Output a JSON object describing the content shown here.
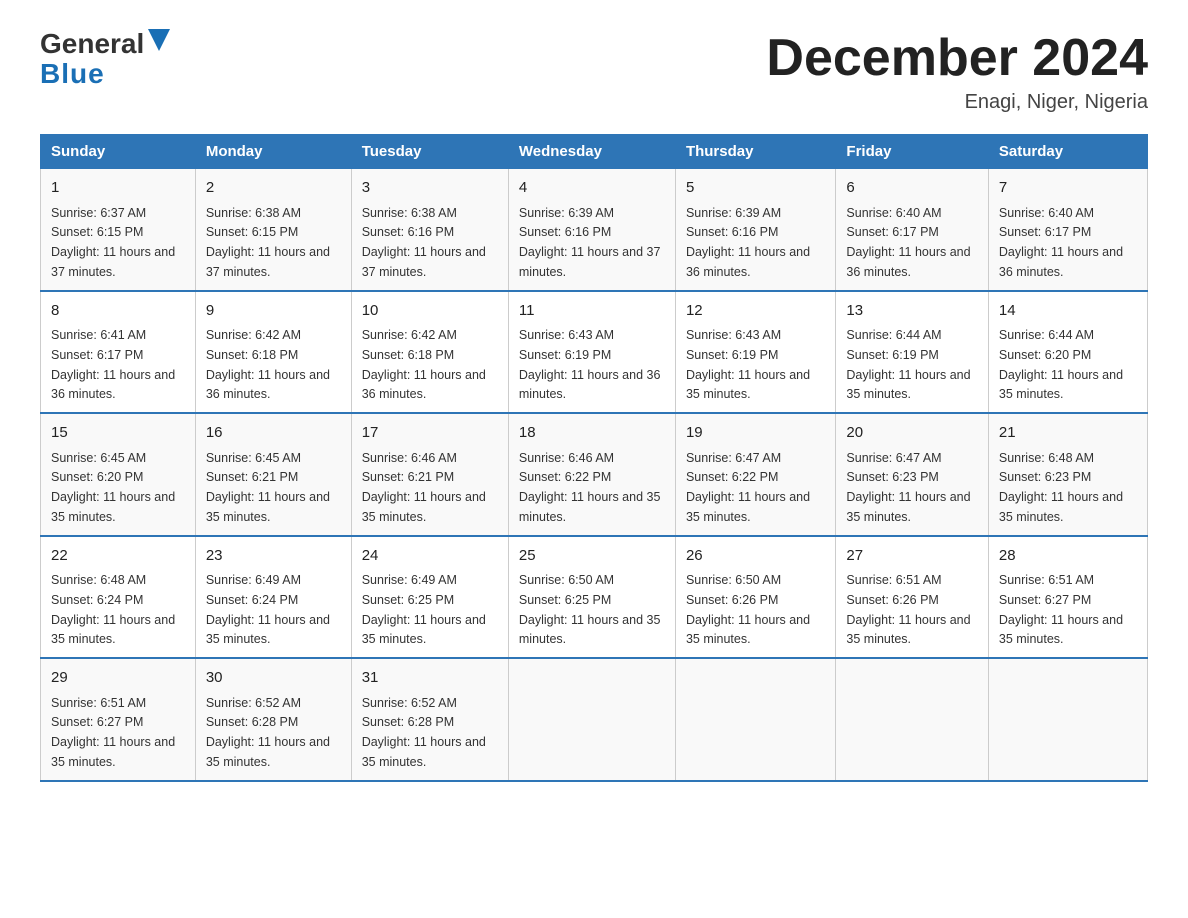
{
  "header": {
    "logo_line1": "General",
    "logo_line2": "Blue",
    "month_title": "December 2024",
    "location": "Enagi, Niger, Nigeria"
  },
  "days_of_week": [
    "Sunday",
    "Monday",
    "Tuesday",
    "Wednesday",
    "Thursday",
    "Friday",
    "Saturday"
  ],
  "weeks": [
    [
      {
        "day": "1",
        "sunrise": "6:37 AM",
        "sunset": "6:15 PM",
        "daylight": "11 hours and 37 minutes."
      },
      {
        "day": "2",
        "sunrise": "6:38 AM",
        "sunset": "6:15 PM",
        "daylight": "11 hours and 37 minutes."
      },
      {
        "day": "3",
        "sunrise": "6:38 AM",
        "sunset": "6:16 PM",
        "daylight": "11 hours and 37 minutes."
      },
      {
        "day": "4",
        "sunrise": "6:39 AM",
        "sunset": "6:16 PM",
        "daylight": "11 hours and 37 minutes."
      },
      {
        "day": "5",
        "sunrise": "6:39 AM",
        "sunset": "6:16 PM",
        "daylight": "11 hours and 36 minutes."
      },
      {
        "day": "6",
        "sunrise": "6:40 AM",
        "sunset": "6:17 PM",
        "daylight": "11 hours and 36 minutes."
      },
      {
        "day": "7",
        "sunrise": "6:40 AM",
        "sunset": "6:17 PM",
        "daylight": "11 hours and 36 minutes."
      }
    ],
    [
      {
        "day": "8",
        "sunrise": "6:41 AM",
        "sunset": "6:17 PM",
        "daylight": "11 hours and 36 minutes."
      },
      {
        "day": "9",
        "sunrise": "6:42 AM",
        "sunset": "6:18 PM",
        "daylight": "11 hours and 36 minutes."
      },
      {
        "day": "10",
        "sunrise": "6:42 AM",
        "sunset": "6:18 PM",
        "daylight": "11 hours and 36 minutes."
      },
      {
        "day": "11",
        "sunrise": "6:43 AM",
        "sunset": "6:19 PM",
        "daylight": "11 hours and 36 minutes."
      },
      {
        "day": "12",
        "sunrise": "6:43 AM",
        "sunset": "6:19 PM",
        "daylight": "11 hours and 35 minutes."
      },
      {
        "day": "13",
        "sunrise": "6:44 AM",
        "sunset": "6:19 PM",
        "daylight": "11 hours and 35 minutes."
      },
      {
        "day": "14",
        "sunrise": "6:44 AM",
        "sunset": "6:20 PM",
        "daylight": "11 hours and 35 minutes."
      }
    ],
    [
      {
        "day": "15",
        "sunrise": "6:45 AM",
        "sunset": "6:20 PM",
        "daylight": "11 hours and 35 minutes."
      },
      {
        "day": "16",
        "sunrise": "6:45 AM",
        "sunset": "6:21 PM",
        "daylight": "11 hours and 35 minutes."
      },
      {
        "day": "17",
        "sunrise": "6:46 AM",
        "sunset": "6:21 PM",
        "daylight": "11 hours and 35 minutes."
      },
      {
        "day": "18",
        "sunrise": "6:46 AM",
        "sunset": "6:22 PM",
        "daylight": "11 hours and 35 minutes."
      },
      {
        "day": "19",
        "sunrise": "6:47 AM",
        "sunset": "6:22 PM",
        "daylight": "11 hours and 35 minutes."
      },
      {
        "day": "20",
        "sunrise": "6:47 AM",
        "sunset": "6:23 PM",
        "daylight": "11 hours and 35 minutes."
      },
      {
        "day": "21",
        "sunrise": "6:48 AM",
        "sunset": "6:23 PM",
        "daylight": "11 hours and 35 minutes."
      }
    ],
    [
      {
        "day": "22",
        "sunrise": "6:48 AM",
        "sunset": "6:24 PM",
        "daylight": "11 hours and 35 minutes."
      },
      {
        "day": "23",
        "sunrise": "6:49 AM",
        "sunset": "6:24 PM",
        "daylight": "11 hours and 35 minutes."
      },
      {
        "day": "24",
        "sunrise": "6:49 AM",
        "sunset": "6:25 PM",
        "daylight": "11 hours and 35 minutes."
      },
      {
        "day": "25",
        "sunrise": "6:50 AM",
        "sunset": "6:25 PM",
        "daylight": "11 hours and 35 minutes."
      },
      {
        "day": "26",
        "sunrise": "6:50 AM",
        "sunset": "6:26 PM",
        "daylight": "11 hours and 35 minutes."
      },
      {
        "day": "27",
        "sunrise": "6:51 AM",
        "sunset": "6:26 PM",
        "daylight": "11 hours and 35 minutes."
      },
      {
        "day": "28",
        "sunrise": "6:51 AM",
        "sunset": "6:27 PM",
        "daylight": "11 hours and 35 minutes."
      }
    ],
    [
      {
        "day": "29",
        "sunrise": "6:51 AM",
        "sunset": "6:27 PM",
        "daylight": "11 hours and 35 minutes."
      },
      {
        "day": "30",
        "sunrise": "6:52 AM",
        "sunset": "6:28 PM",
        "daylight": "11 hours and 35 minutes."
      },
      {
        "day": "31",
        "sunrise": "6:52 AM",
        "sunset": "6:28 PM",
        "daylight": "11 hours and 35 minutes."
      },
      {
        "day": "",
        "sunrise": "",
        "sunset": "",
        "daylight": ""
      },
      {
        "day": "",
        "sunrise": "",
        "sunset": "",
        "daylight": ""
      },
      {
        "day": "",
        "sunrise": "",
        "sunset": "",
        "daylight": ""
      },
      {
        "day": "",
        "sunrise": "",
        "sunset": "",
        "daylight": ""
      }
    ]
  ]
}
